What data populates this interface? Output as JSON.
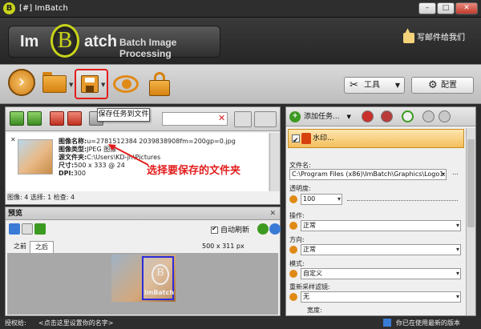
{
  "window": {
    "title": "[#] ImBatch"
  },
  "logo": {
    "left": "Im",
    "b": "B",
    "right": "atch",
    "subtitle": "Batch Image Processing"
  },
  "header": {
    "mail_label": "写邮件给我们"
  },
  "toolbar": {
    "tools_label": "工具",
    "config_label": "配置"
  },
  "tooltip": {
    "text": "保存任务到文件"
  },
  "file": {
    "name_label": "图像名称:",
    "name_value": "u=2781512384 2039838908fm=200gp=0.jpg",
    "type_label": "图像类型:",
    "type_value": "JPEG 图像",
    "folder_label": "源文件夹:",
    "folder_value": "C:\\Users\\KD-jh\\Pictures",
    "size_label": "尺寸:",
    "size_value": "500 x 333 @ 24",
    "dpi_label": "DPI:",
    "dpi_value": "300"
  },
  "left_status": "图像: 4  选择: 1  检查: 4",
  "annotation": "选择要保存的文件夹",
  "preview": {
    "title": "预览",
    "auto_refresh": "自动刷新",
    "tab_before": "之前",
    "tab_after": "之后",
    "dimensions": "500 x 311 px",
    "watermark_text": "ImBatch"
  },
  "tasks": {
    "add_task": "添加任务...",
    "task_name": "水印...",
    "filename_label": "文件名:",
    "filename_value": "C:\\Program Files (x86)\\ImBatch\\Graphics\\Logo1.png",
    "opacity_label": "透明度:",
    "opacity_value": "100",
    "operation_label": "操作:",
    "operation_value": "正常",
    "direction_label": "方向:",
    "direction_value": "正常",
    "mode_label": "模式:",
    "mode_value": "自定义",
    "resample_label": "重新采样滤镜:",
    "resample_value": "无",
    "width_label": "宽度:"
  },
  "status": {
    "license": "授权给:",
    "register": "<点击这里设置你的名字>",
    "update": "你已在使用最新的版本"
  },
  "colors": {
    "accent_orange": "#e08a16",
    "highlight_red": "#e31d1d",
    "logo_green": "#c8d41a"
  },
  "icons": [
    "play-icon",
    "folder-icon",
    "save-icon",
    "eye-icon",
    "bag-icon",
    "tools-icon",
    "gear-icon",
    "mail-icon"
  ]
}
